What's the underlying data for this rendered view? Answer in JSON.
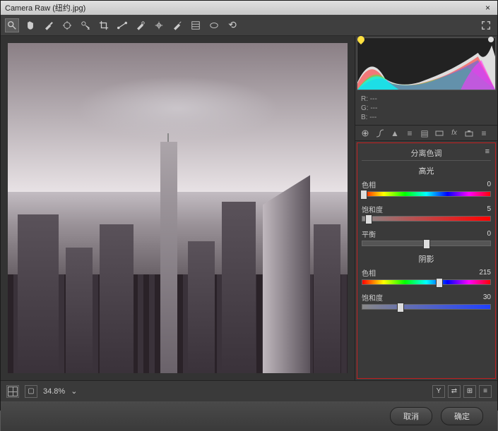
{
  "window": {
    "title": "Camera Raw (纽约.jpg)"
  },
  "toolbar": {
    "tools": [
      "zoom",
      "hand",
      "eyedropper",
      "sampler",
      "target",
      "crop",
      "straighten",
      "spot",
      "eye",
      "brush",
      "gradient",
      "radial",
      "rotate"
    ],
    "expand_icon": "expand"
  },
  "readout": {
    "r": "R:  ---",
    "g": "G:  ---",
    "b": "B:  ---"
  },
  "tabs": [
    "basic",
    "curve",
    "detail",
    "hsl",
    "split",
    "lens",
    "fx",
    "camera",
    "preset"
  ],
  "panel": {
    "title": "分离色调",
    "highlights": {
      "title": "高光",
      "hue_label": "色相",
      "hue_value": "0",
      "sat_label": "饱和度",
      "sat_value": "5"
    },
    "balance": {
      "label": "平衡",
      "value": "0"
    },
    "shadows": {
      "title": "阴影",
      "hue_label": "色相",
      "hue_value": "215",
      "sat_label": "饱和度",
      "sat_value": "30"
    }
  },
  "status": {
    "zoom": "34.8%",
    "compare": "Y"
  },
  "footer": {
    "cancel": "取消",
    "ok": "确定"
  }
}
